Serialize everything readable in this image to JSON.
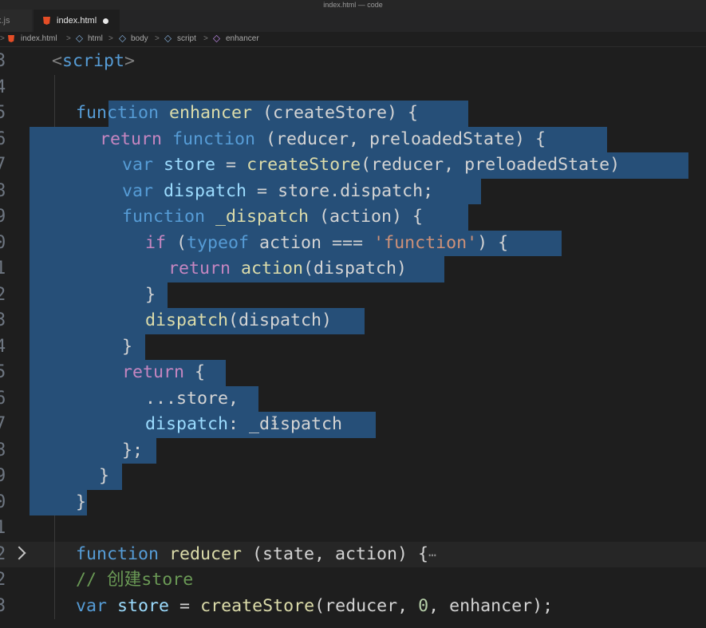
{
  "window": {
    "title": "index.html — code"
  },
  "tabs": [
    {
      "label": "x.js"
    },
    {
      "label": "index.html"
    }
  ],
  "breadcrumb": {
    "items": [
      "index.html",
      "html",
      "body",
      "script",
      "enhancer"
    ],
    "separator": ">"
  },
  "editor": {
    "lines": [
      {
        "n": "3"
      },
      {
        "n": "4"
      },
      {
        "n": "5"
      },
      {
        "n": "6"
      },
      {
        "n": "7"
      },
      {
        "n": "8"
      },
      {
        "n": "9"
      },
      {
        "n": "0"
      },
      {
        "n": "1"
      },
      {
        "n": "2"
      },
      {
        "n": "3"
      },
      {
        "n": "4"
      },
      {
        "n": "5"
      },
      {
        "n": "6"
      },
      {
        "n": "7"
      },
      {
        "n": "8"
      },
      {
        "n": "9"
      },
      {
        "n": "0"
      },
      {
        "n": "1"
      },
      {
        "n": "2"
      },
      {
        "n": "2"
      },
      {
        "n": "3"
      }
    ],
    "code": {
      "l3": {
        "open": "<",
        "tag": "script",
        "close": ">"
      },
      "l5": {
        "kw": "function",
        "name": "enhancer",
        "rest": " (createStore) {"
      },
      "l6": {
        "ret": "return",
        "kw": "function",
        "rest": " (reducer, preloadedState) {"
      },
      "l7": {
        "kw": "var",
        "v": "store",
        "eq": " = ",
        "fn": "createStore",
        "rest": "(reducer, preloadedState)"
      },
      "l8": {
        "kw": "var",
        "v": "dispatch",
        "eq": " = ",
        "rest": "store.dispatch;"
      },
      "l9": {
        "kw": "function",
        "name": "_dispatch",
        "rest": " (action) {"
      },
      "l10": {
        "ret": "if",
        "p1": " (",
        "kw": "typeof",
        "mid": " action === ",
        "str": "'function'",
        "rest": ") {"
      },
      "l11": {
        "ret": "return",
        "fn": "action",
        "rest": "(dispatch)"
      },
      "l12": {
        "rest": "}"
      },
      "l13": {
        "fn": "dispatch",
        "rest": "(dispatch)"
      },
      "l14": {
        "rest": "}"
      },
      "l15": {
        "ret": "return",
        "rest": " {"
      },
      "l16": {
        "rest": "...store,"
      },
      "l17": {
        "v": "dispatch",
        "rest": ": _dispatch"
      },
      "l18": {
        "rest": "};"
      },
      "l19": {
        "rest": "}"
      },
      "l20": {
        "rest": "}"
      },
      "l22": {
        "kw": "function",
        "name": "reducer",
        "rest": " (state, action) {",
        "fold": "⋯"
      },
      "l23": {
        "cmt": "// 创建store"
      },
      "l24": {
        "kw": "var",
        "v": "store",
        "eq": " = ",
        "fn": "createStore",
        "p": "(reducer, ",
        "num": "0",
        "rest": ", enhancer);"
      }
    }
  },
  "colors": {
    "selection": "#264f78",
    "keyword": "#569cd6",
    "control": "#c586c0",
    "function": "#dcdcaa",
    "variable": "#9cdcfe",
    "string": "#ce9178",
    "comment": "#6a9955",
    "background": "#1e1e1e"
  },
  "icons": [
    "html5-file-icon",
    "symbol-module-icon",
    "symbol-method-icon",
    "fold-chevron-right-icon",
    "text-cursor-icon"
  ]
}
